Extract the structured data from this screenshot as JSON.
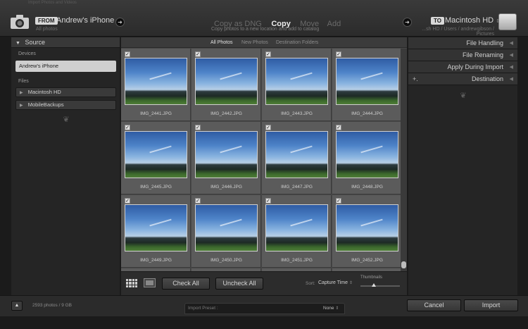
{
  "window": {
    "title": "Import Photos and Videos"
  },
  "top": {
    "from_chip": "FROM",
    "source_name": "Andrew's iPhone",
    "source_sub": "All photos",
    "modes": [
      {
        "label": "Copy as DNG",
        "active": false
      },
      {
        "label": "Copy",
        "active": true
      },
      {
        "label": "Move",
        "active": false
      },
      {
        "label": "Add",
        "active": false
      }
    ],
    "mode_desc": "Copy photos to a new location and add to catalog",
    "to_chip": "TO",
    "dest_name": "Macintosh HD",
    "dest_path": "...sh HD / Users / andrewgibson / Pictures"
  },
  "source_panel": {
    "title": "Source",
    "devices_label": "Devices",
    "device": "Andrew's iPhone",
    "files_label": "Files",
    "drives": [
      "Macintosh HD",
      "MobileBackups"
    ]
  },
  "filters": [
    {
      "label": "All Photos",
      "active": true
    },
    {
      "label": "New Photos",
      "active": false
    },
    {
      "label": "Destination Folders",
      "active": false
    }
  ],
  "photos": [
    "IMG_2441.JPG",
    "IMG_2442.JPG",
    "IMG_2443.JPG",
    "IMG_2444.JPG",
    "IMG_2445.JPG",
    "IMG_2446.JPG",
    "IMG_2447.JPG",
    "IMG_2448.JPG",
    "IMG_2449.JPG",
    "IMG_2450.JPG",
    "IMG_2451.JPG",
    "IMG_2452.JPG"
  ],
  "toolbar": {
    "check_all": "Check All",
    "uncheck_all": "Uncheck All",
    "sort_label": "Sort:",
    "sort_value": "Capture Time",
    "thumbnails_label": "Thumbnails"
  },
  "right_panel": {
    "sections": [
      "File Handling",
      "File Renaming",
      "Apply During Import",
      "Destination"
    ]
  },
  "bottom": {
    "count": "2593 photos / 9 GB",
    "preset_label": "Import Preset :",
    "preset_value": "None",
    "cancel": "Cancel",
    "import": "Import"
  },
  "colors": {
    "checkbox": "#e0e0e0",
    "panel": "#252525",
    "grid_bg": "#464646"
  }
}
